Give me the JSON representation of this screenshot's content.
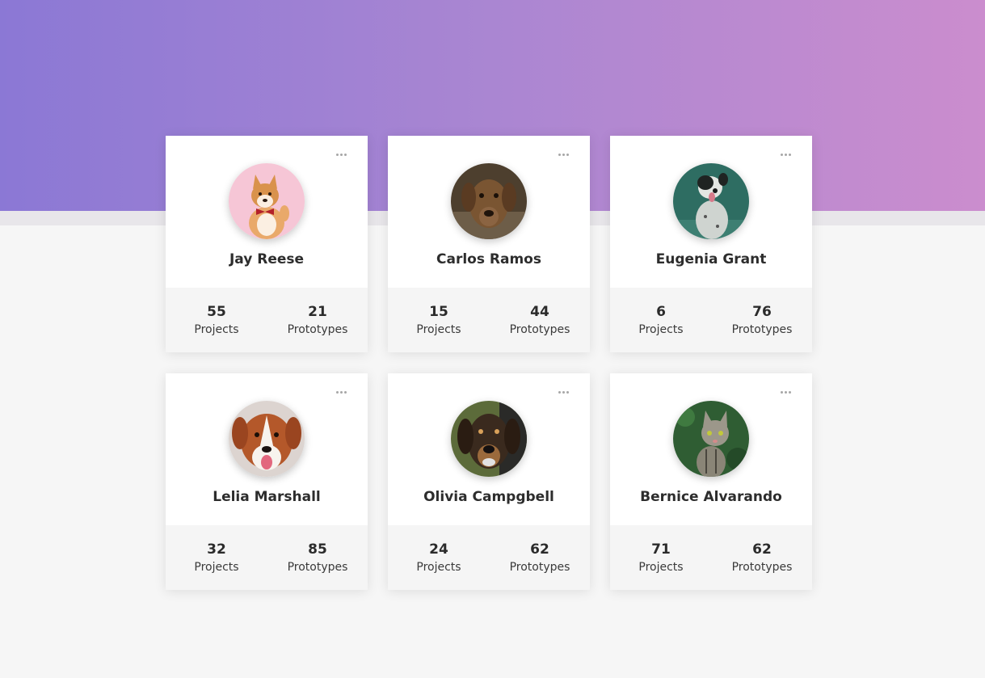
{
  "cards": [
    {
      "name": "Jay Reese",
      "projects": "55",
      "projects_label": "Projects",
      "prototypes": "21",
      "prototypes_label": "Prototypes",
      "avatar_bg": "#f6c6d6",
      "avatar_fg": "#d9924c"
    },
    {
      "name": "Carlos Ramos",
      "projects": "15",
      "projects_label": "Projects",
      "prototypes": "44",
      "prototypes_label": "Prototypes",
      "avatar_bg": "#4d3f2e",
      "avatar_fg": "#7a5532"
    },
    {
      "name": "Eugenia Grant",
      "projects": "6",
      "projects_label": "Projects",
      "prototypes": "76",
      "prototypes_label": "Prototypes",
      "avatar_bg": "#2e6d62",
      "avatar_fg": "#d8dcd8"
    },
    {
      "name": "Lelia Marshall",
      "projects": "32",
      "projects_label": "Projects",
      "prototypes": "85",
      "prototypes_label": "Prototypes",
      "avatar_bg": "#dcd4d0",
      "avatar_fg": "#b4582a"
    },
    {
      "name": "Olivia Campgbell",
      "projects": "24",
      "projects_label": "Projects",
      "prototypes": "62",
      "prototypes_label": "Prototypes",
      "avatar_bg": "#5c6b3a",
      "avatar_fg": "#3a2a1e"
    },
    {
      "name": "Bernice Alvarando",
      "projects": "71",
      "projects_label": "Projects",
      "prototypes": "62",
      "prototypes_label": "Prototypes",
      "avatar_bg": "#2f5d33",
      "avatar_fg": "#8a8577"
    }
  ],
  "colors": {
    "hero_start": "#8b78d5",
    "hero_end": "#cb8dce",
    "page_bg": "#f6f6f6"
  },
  "icons": {
    "menu": "more-dots-icon"
  }
}
